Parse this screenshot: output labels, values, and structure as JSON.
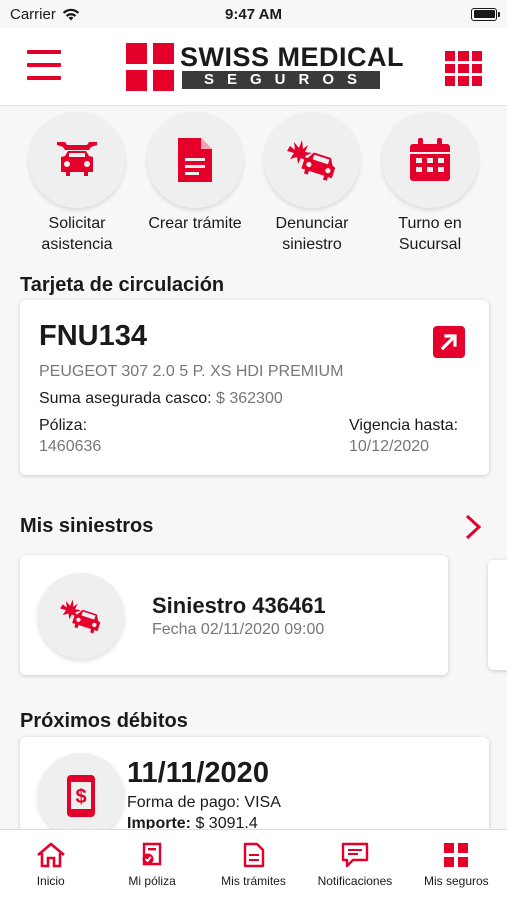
{
  "status_bar": {
    "carrier": "Carrier",
    "time": "9:47 AM"
  },
  "header": {
    "logo_top": "SWISS MEDICAL",
    "logo_bottom": "SEGUROS",
    "menu_icon": "hamburger-menu-icon",
    "apps_icon": "grid-apps-icon"
  },
  "quick_actions": [
    {
      "label_line1": "Solicitar",
      "label_line2": "asistencia",
      "icon": "car-tools-icon"
    },
    {
      "label_line1": "Crear trámite",
      "label_line2": "",
      "icon": "document-icon"
    },
    {
      "label_line1": "Denunciar",
      "label_line2": "siniestro",
      "icon": "car-crash-icon"
    },
    {
      "label_line1": "Turno en",
      "label_line2": "Sucursal",
      "icon": "calendar-icon"
    }
  ],
  "circulation": {
    "title": "Tarjeta de circulación",
    "plate": "FNU134",
    "model": "PEUGEOT 307 2.0 5 P. XS HDI PREMIUM",
    "insured_label": "Suma asegurada casco:",
    "insured_value": "$ 362300",
    "policy_label": "Póliza:",
    "policy_value": "1460636",
    "validity_label": "Vigencia hasta:",
    "validity_value": "10/12/2020"
  },
  "claims": {
    "title": "Mis siniestros",
    "items": [
      {
        "name": "Siniestro 436461",
        "date": "Fecha 02/11/2020 09:00"
      }
    ]
  },
  "debits": {
    "title": "Próximos débitos",
    "date": "11/11/2020",
    "payment": "Forma de pago: VISA",
    "amount_label": "Importe:",
    "amount_value": "$ 3091.4"
  },
  "tabs": [
    {
      "label": "Inicio",
      "icon": "home-icon"
    },
    {
      "label": "Mi póliza",
      "icon": "policy-icon"
    },
    {
      "label": "Mis trámites",
      "icon": "document-icon"
    },
    {
      "label": "Notificaciones",
      "icon": "chat-icon"
    },
    {
      "label": "Mis seguros",
      "icon": "grid-icon"
    }
  ],
  "colors": {
    "brand_red": "#e4002b",
    "text": "#1a1a1a",
    "muted": "#777777",
    "background": "#f7f7f7"
  }
}
